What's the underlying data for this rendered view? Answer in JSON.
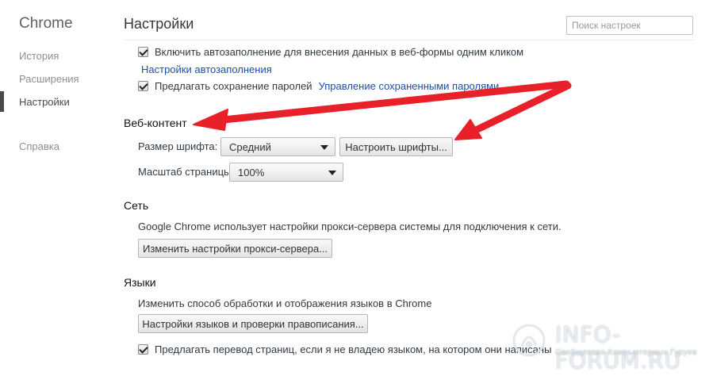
{
  "sidebar": {
    "brand": "Chrome",
    "items": [
      {
        "label": "История"
      },
      {
        "label": "Расширения"
      },
      {
        "label": "Настройки"
      },
      {
        "label": "Справка"
      }
    ]
  },
  "header": {
    "title": "Настройки",
    "search_placeholder": "Поиск настроек"
  },
  "autofill": {
    "checkbox_label": "Включить автозаполнение для внесения данных в веб-формы одним кликом",
    "checked": true,
    "settings_link": "Настройки автозаполнения"
  },
  "passwords": {
    "checkbox_label": "Предлагать сохранение паролей",
    "checked": true,
    "manage_link": "Управление сохраненными паролями"
  },
  "web_content": {
    "title": "Веб-контент",
    "font_size_label": "Размер шрифта:",
    "font_size_value": "Средний",
    "customize_fonts_button": "Настроить шрифты...",
    "zoom_label": "Масштаб страницы:",
    "zoom_value": "100%"
  },
  "network": {
    "title": "Сеть",
    "description": "Google Chrome использует настройки прокси-сервера системы для подключения к сети.",
    "proxy_button": "Изменить настройки прокси-сервера..."
  },
  "languages": {
    "title": "Языки",
    "description": "Изменить способ обработки и отображения языков в Chrome",
    "language_button": "Настройки языков и проверки правописания...",
    "translate_checkbox_label": "Предлагать перевод страниц, если я не владею языком, на котором они написаны",
    "translate_checked": true
  },
  "annotation": {
    "arrow_color": "#e8202a"
  },
  "watermark": {
    "title": "INFO-FORUM.RU",
    "subtitle": "Сообщество Компьютерных Гуруев"
  }
}
